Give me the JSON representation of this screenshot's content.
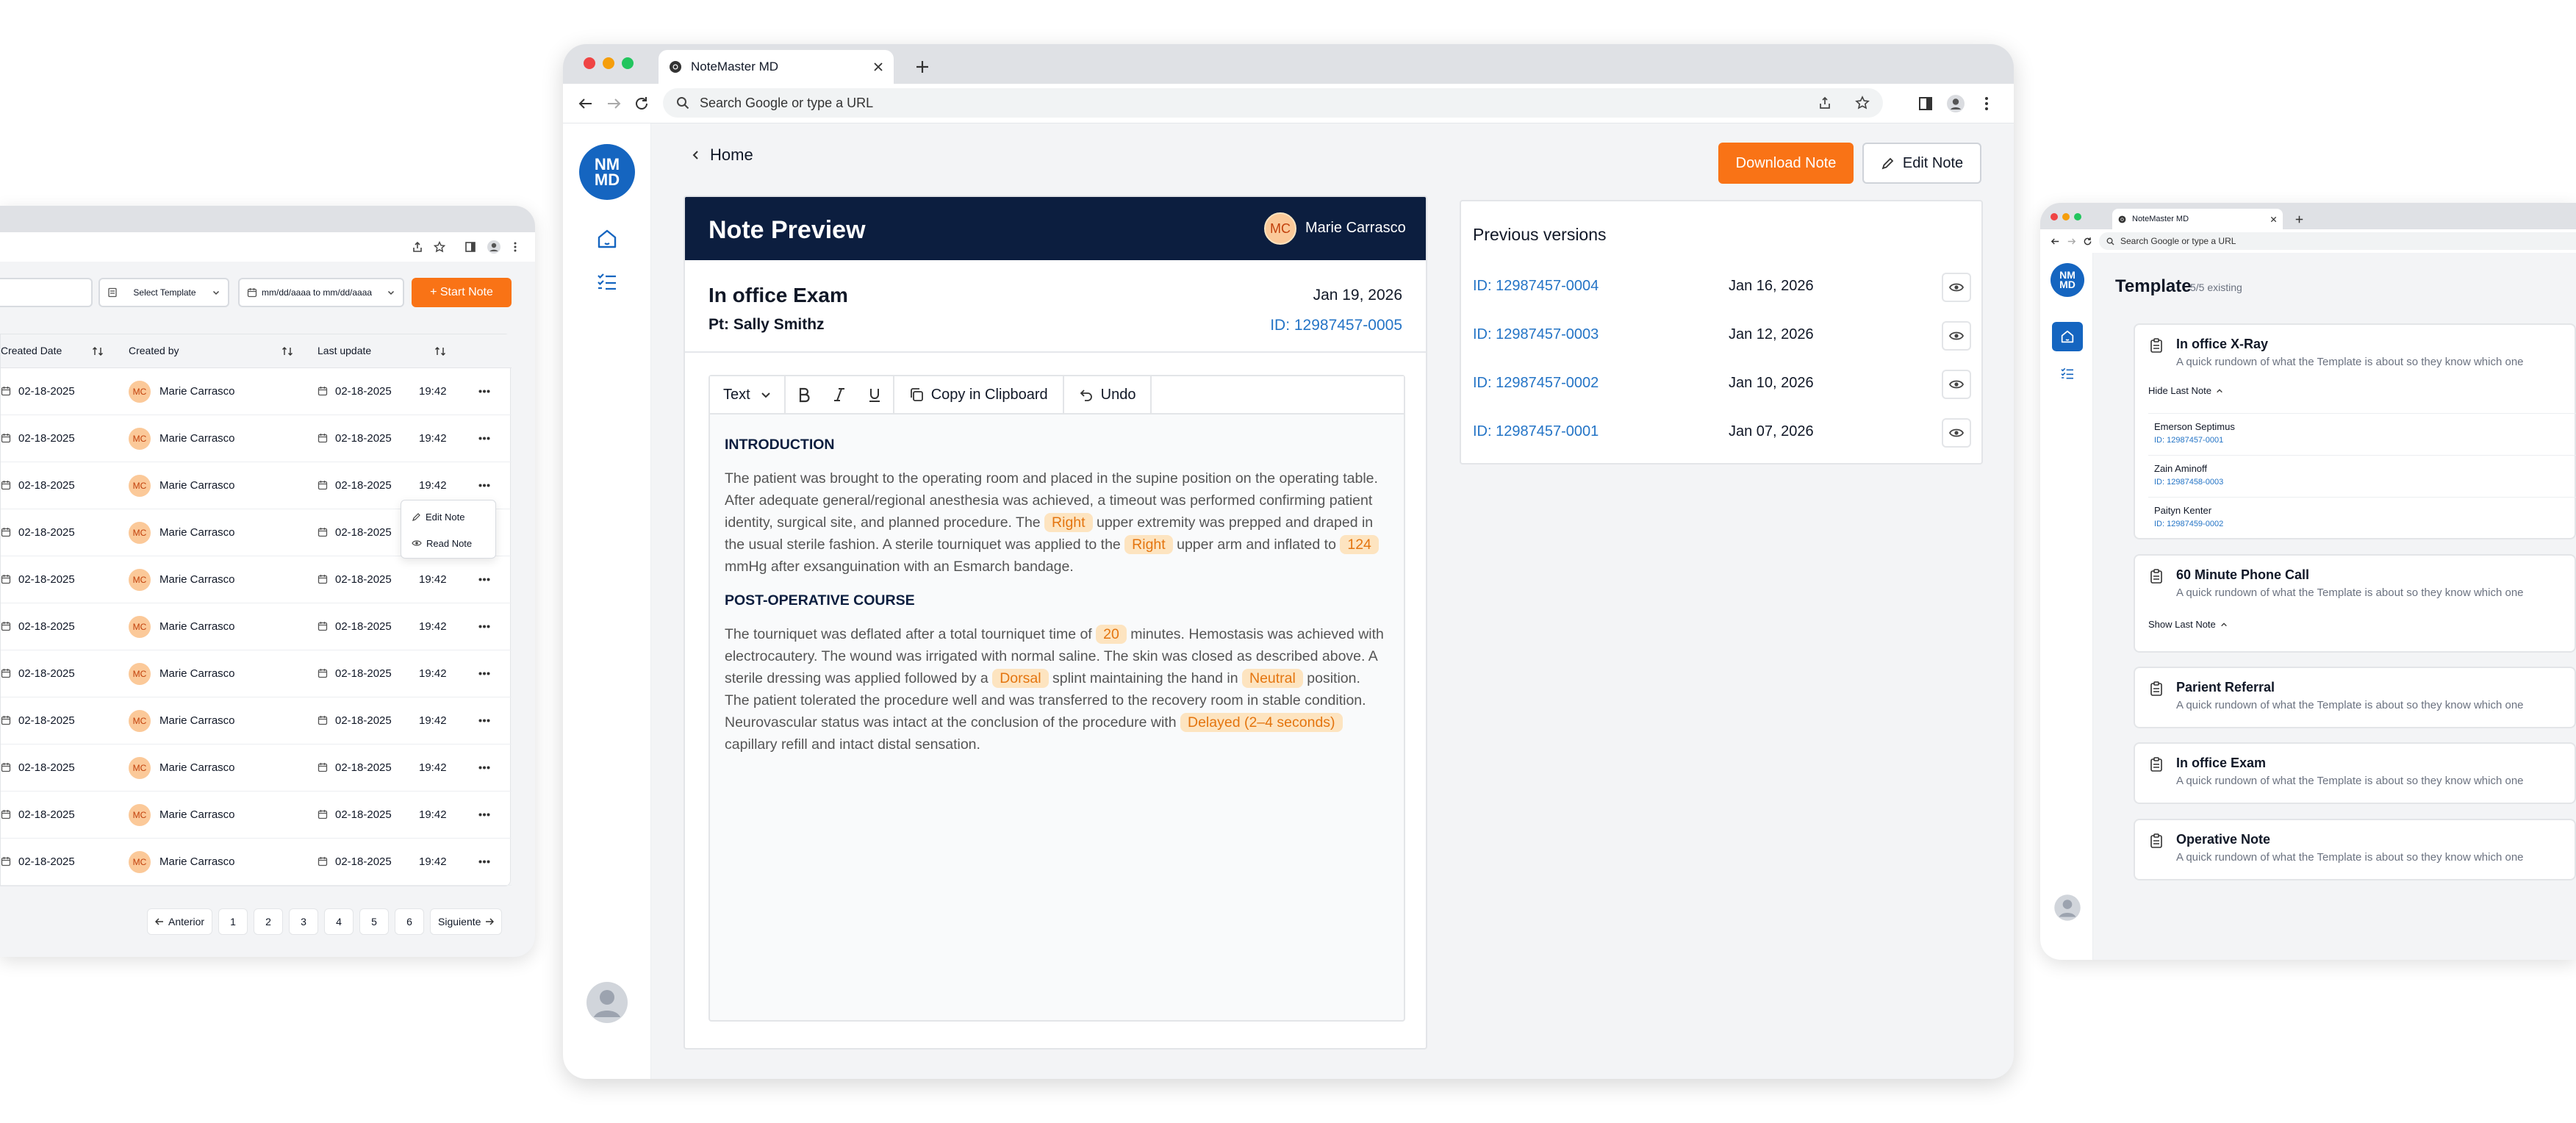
{
  "left": {
    "search": {
      "placeholder": ""
    },
    "filters": {
      "template": "Select Template",
      "date_range": "mm/dd/aaaa to mm/dd/aaaa"
    },
    "start_button": "+ Start Note",
    "columns": [
      "Created Date",
      "Created by",
      "Last update"
    ],
    "rows": [
      {
        "created": "02-18-2025",
        "avatar": "MC",
        "author": "Marie Carrasco",
        "updated": "02-18-2025",
        "time": "19:42"
      },
      {
        "created": "02-18-2025",
        "avatar": "MC",
        "author": "Marie Carrasco",
        "updated": "02-18-2025",
        "time": "19:42"
      },
      {
        "created": "02-18-2025",
        "avatar": "MC",
        "author": "Marie Carrasco",
        "updated": "02-18-2025",
        "time": "19:42"
      },
      {
        "created": "02-18-2025",
        "avatar": "MC",
        "author": "Marie Carrasco",
        "updated": "02-18-2025",
        "time": "19:42"
      },
      {
        "created": "02-18-2025",
        "avatar": "MC",
        "author": "Marie Carrasco",
        "updated": "02-18-2025",
        "time": "19:42"
      },
      {
        "created": "02-18-2025",
        "avatar": "MC",
        "author": "Marie Carrasco",
        "updated": "02-18-2025",
        "time": "19:42"
      },
      {
        "created": "02-18-2025",
        "avatar": "MC",
        "author": "Marie Carrasco",
        "updated": "02-18-2025",
        "time": "19:42"
      },
      {
        "created": "02-18-2025",
        "avatar": "MC",
        "author": "Marie Carrasco",
        "updated": "02-18-2025",
        "time": "19:42"
      },
      {
        "created": "02-18-2025",
        "avatar": "MC",
        "author": "Marie Carrasco",
        "updated": "02-18-2025",
        "time": "19:42"
      },
      {
        "created": "02-18-2025",
        "avatar": "MC",
        "author": "Marie Carrasco",
        "updated": "02-18-2025",
        "time": "19:42"
      },
      {
        "created": "02-18-2025",
        "avatar": "MC",
        "author": "Marie Carrasco",
        "updated": "02-18-2025",
        "time": "19:42"
      }
    ],
    "row_menu": {
      "edit": "Edit Note",
      "read": "Read Note"
    },
    "pagination": {
      "prev": "Anterior",
      "pages": [
        "1",
        "2",
        "3",
        "4",
        "5",
        "6"
      ],
      "next": "Siguiente"
    }
  },
  "main": {
    "tab_title": "NoteMaster MD",
    "address_placeholder": "Search Google or type a URL",
    "logo": "NM MD",
    "back_label": "Home",
    "download_button": "Download Note",
    "edit_button": "Edit Note",
    "preview": {
      "header_title": "Note Preview",
      "user_initials": "MC",
      "user_name": "Marie Carrasco",
      "note_title": "In office Exam",
      "date": "Jan 19, 2026",
      "patient": "Pt: Sally Smithz",
      "note_id": "ID: 12987457-0005"
    },
    "toolbar": {
      "text_style": "Text",
      "copy": "Copy in Clipboard",
      "undo": "Undo"
    },
    "body": {
      "h1": "INTRODUCTION",
      "p1_a": "The patient was brought to the operating room and placed in the supine position on the operating table. After adequate general/regional anesthesia was achieved, a timeout was performed confirming patient identity, surgical site, and planned procedure. The ",
      "p1_h1": "Right",
      "p1_b": " upper extremity was prepped and draped in the usual sterile fashion. A sterile tourniquet was applied to the ",
      "p1_h2": "Right",
      "p1_c": " upper arm and inflated to ",
      "p1_h3": "124",
      "p1_d": " mmHg after exsanguination with an Esmarch bandage.",
      "h2": "POST-OPERATIVE COURSE",
      "p2_a": "The tourniquet was deflated after a total tourniquet time of ",
      "p2_h1": "20",
      "p2_b": " minutes. Hemostasis was achieved with electrocautery. The wound was irrigated with normal saline. The skin was closed as described above. A sterile dressing was applied followed by a ",
      "p2_h2": "Dorsal",
      "p2_c": " splint maintaining the hand in ",
      "p2_h3": "Neutral",
      "p2_d": " position. The patient tolerated the procedure well and was transferred to the recovery room in stable condition. Neurovascular status was intact at the conclusion of the procedure with ",
      "p2_h4": "Delayed (2–4 seconds)",
      "p2_e": " capillary refill and intact distal sensation."
    },
    "versions": {
      "title": "Previous versions",
      "items": [
        {
          "id": "ID: 12987457-0004",
          "date": "Jan 16, 2026"
        },
        {
          "id": "ID: 12987457-0003",
          "date": "Jan 12, 2026"
        },
        {
          "id": "ID: 12987457-0002",
          "date": "Jan 10, 2026"
        },
        {
          "id": "ID: 12987457-0001",
          "date": "Jan 07, 2026"
        }
      ]
    }
  },
  "right": {
    "tab_title": "NoteMaster MD",
    "address_placeholder": "Search Google or type a URL",
    "logo": "NM MD",
    "title": "Template",
    "count": "5/5 existing",
    "templates": [
      {
        "name": "In office X-Ray",
        "desc": "A quick rundown of what the Template is about so they know which one",
        "toggle": "Hide Last Note",
        "notes": [
          {
            "name": "Emerson Septimus",
            "id": "ID: 12987457-0001"
          },
          {
            "name": "Zain Aminoff",
            "id": "ID: 12987458-0003"
          },
          {
            "name": "Paityn Kenter",
            "id": "ID: 12987459-0002"
          }
        ]
      },
      {
        "name": "60 Minute Phone Call",
        "desc": "A quick rundown of what the Template is about so they know which one",
        "toggle": "Show Last Note"
      },
      {
        "name": "Parient Referral",
        "desc": "A quick rundown of what the Template is about so they know which one"
      },
      {
        "name": "In office Exam",
        "desc": "A quick rundown of what the Template is about so they know which one"
      },
      {
        "name": "Operative Note",
        "desc": "A quick rundown of what the Template is about so they know which one"
      }
    ]
  },
  "colors": {
    "accent": "#f97316",
    "navy": "#0c1e3f",
    "blue": "#1565c0",
    "link": "#2474c6",
    "highlight": "#fde4c0"
  }
}
